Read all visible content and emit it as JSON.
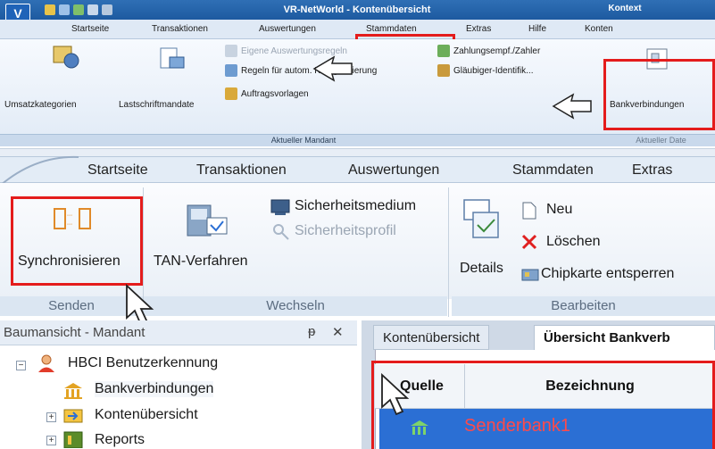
{
  "top": {
    "window_title": "VR-NetWorld - Kontenübersicht",
    "context_title": "Kontext",
    "tabs": [
      "Startseite",
      "Transaktionen",
      "Auswertungen",
      "Stammdaten",
      "Extras",
      "Hilfe",
      "Konten"
    ],
    "ribbon": {
      "umsatzkategorien": "Umsatzkategorien",
      "lastschriftmandate": "Lastschriftmandate",
      "eigene_regeln": "Eigene Auswertungsregeln",
      "regeln_autom": "Regeln für autom. Kategorisierung",
      "auftragsvorlagen": "Auftragsvorlagen",
      "zahlungsempf": "Zahlungsempf./Zahler",
      "glaeubiger": "Gläubiger-Identifik...",
      "bankverbindungen": "Bankverbindungen"
    },
    "group_label_1": "Aktueller Mandant",
    "group_label_2": "Aktueller Date"
  },
  "zoom": {
    "tabs": [
      "Startseite",
      "Transaktionen",
      "Auswertungen",
      "Stammdaten",
      "Extras"
    ],
    "ribbon": {
      "synchronisieren": "Synchronisieren",
      "tan_verfahren": "TAN-Verfahren",
      "sicherheitsmedium": "Sicherheitsmedium",
      "sicherheitsprofil": "Sicherheitsprofil",
      "details": "Details",
      "neu": "Neu",
      "loeschen": "Löschen",
      "chipkarte": "Chipkarte entsperren"
    },
    "groups": {
      "senden": "Senden",
      "wechseln": "Wechseln",
      "bearbeiten": "Bearbeiten"
    },
    "tree": {
      "title": "Baumansicht - Mandant",
      "pin": "ᵽ",
      "close": "✕",
      "items": [
        "HBCI Benutzerkennung",
        "Bankverbindungen",
        "Kontenübersicht",
        "Reports"
      ]
    },
    "tabs_right": [
      "Kontenübersicht",
      "Übersicht Bankverb"
    ],
    "grid": {
      "columns": [
        "Quelle",
        "Bezeichnung"
      ],
      "row": "Senderbank1"
    }
  },
  "colors": {
    "highlight_red": "#e41c1c",
    "selection_blue": "#2b6fd4",
    "accent_blue": "#1d5aa0"
  }
}
